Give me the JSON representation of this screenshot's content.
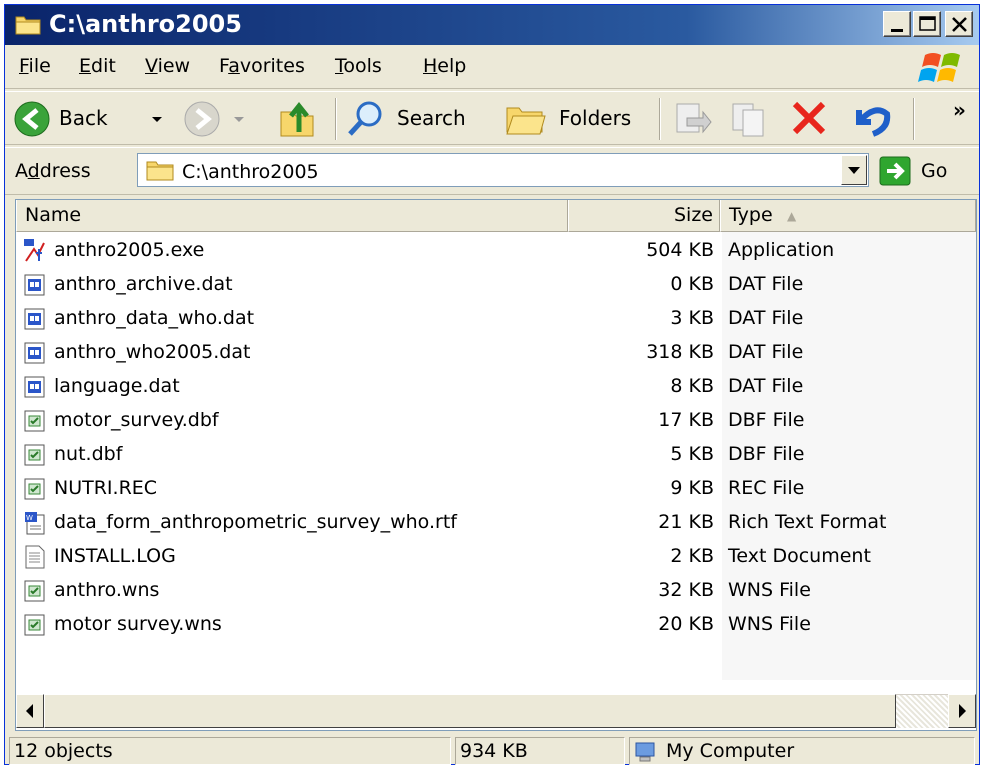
{
  "window": {
    "title": "C:\\anthro2005"
  },
  "menu": {
    "items": [
      {
        "pre": "",
        "u": "F",
        "post": "ile"
      },
      {
        "pre": "",
        "u": "E",
        "post": "dit"
      },
      {
        "pre": "",
        "u": "V",
        "post": "iew"
      },
      {
        "pre": "F",
        "u": "a",
        "post": "vorites"
      },
      {
        "pre": "",
        "u": "T",
        "post": "ools"
      },
      {
        "pre": "",
        "u": "H",
        "post": "elp"
      }
    ]
  },
  "toolbar": {
    "back_label": "Back",
    "search_label": "Search",
    "folders_label": "Folders",
    "chevron": "»"
  },
  "address": {
    "label_pre": "A",
    "label_u": "d",
    "label_post": "dress",
    "value": "C:\\anthro2005",
    "go_label": "Go"
  },
  "columns": {
    "name": "Name",
    "size": "Size",
    "type": "Type",
    "sort_indicator": "▲"
  },
  "files": [
    {
      "name": "anthro2005.exe",
      "size": "504 KB",
      "type": "Application",
      "icon": "who-app-icon"
    },
    {
      "name": "anthro_archive.dat",
      "size": "0 KB",
      "type": "DAT File",
      "icon": "dat-file-icon"
    },
    {
      "name": "anthro_data_who.dat",
      "size": "3 KB",
      "type": "DAT File",
      "icon": "dat-file-icon"
    },
    {
      "name": "anthro_who2005.dat",
      "size": "318 KB",
      "type": "DAT File",
      "icon": "dat-file-icon"
    },
    {
      "name": "language.dat",
      "size": "8 KB",
      "type": "DAT File",
      "icon": "dat-file-icon"
    },
    {
      "name": "motor_survey.dbf",
      "size": "17 KB",
      "type": "DBF File",
      "icon": "generic-file-icon"
    },
    {
      "name": "nut.dbf",
      "size": "5 KB",
      "type": "DBF File",
      "icon": "generic-file-icon"
    },
    {
      "name": "NUTRI.REC",
      "size": "9 KB",
      "type": "REC File",
      "icon": "generic-file-icon"
    },
    {
      "name": "data_form_anthropometric_survey_who.rtf",
      "size": "21 KB",
      "type": "Rich Text Format",
      "icon": "wordpad-doc-icon"
    },
    {
      "name": "INSTALL.LOG",
      "size": "2 KB",
      "type": "Text Document",
      "icon": "text-doc-icon"
    },
    {
      "name": "anthro.wns",
      "size": "32 KB",
      "type": "WNS File",
      "icon": "generic-file-icon"
    },
    {
      "name": "motor survey.wns",
      "size": "20 KB",
      "type": "WNS File",
      "icon": "generic-file-icon"
    }
  ],
  "status": {
    "objects": "12 objects",
    "size": "934 KB",
    "location": "My Computer"
  }
}
